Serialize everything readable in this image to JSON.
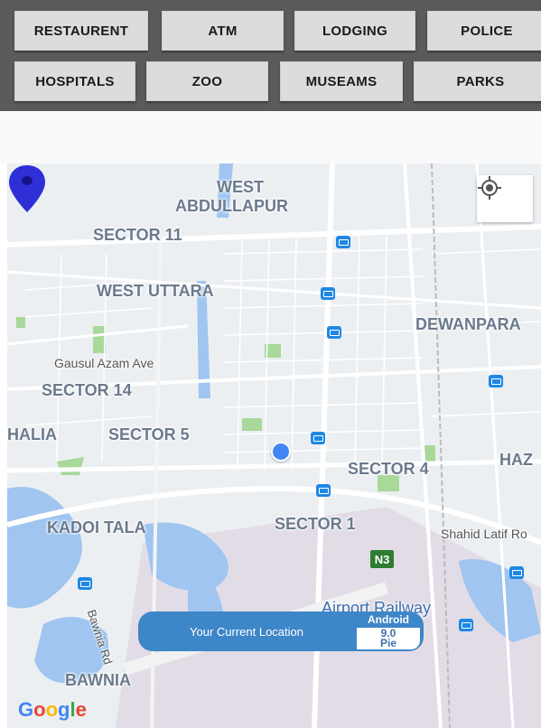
{
  "categories": [
    {
      "id": "restaurent",
      "label": "RESTAURENT"
    },
    {
      "id": "atm",
      "label": "ATM"
    },
    {
      "id": "lodging",
      "label": "LODGING"
    },
    {
      "id": "police",
      "label": "POLICE"
    },
    {
      "id": "hospitals",
      "label": "HOSPITALS"
    },
    {
      "id": "zoo",
      "label": "ZOO"
    },
    {
      "id": "museams",
      "label": "MUSEAMS"
    },
    {
      "id": "parks",
      "label": "PARKS"
    }
  ],
  "map": {
    "labels": {
      "west_abdullapur_1": "WEST",
      "west_abdullapur_2": "ABDULLAPUR",
      "sector_11": "SECTOR 11",
      "west_uttara": "WEST UTTARA",
      "dewanpara": "DEWANPARA",
      "gausul_azam_ave": "Gausul Azam Ave",
      "sector_14": "SECTOR 14",
      "halia": "HALIA",
      "sector_5": "SECTOR 5",
      "haz": "HAZ",
      "sector_4": "SECTOR 4",
      "kadoi_tala": "KADOI TALA",
      "sector_1": "SECTOR 1",
      "shahid_latif": "Shahid Latif Ro",
      "n3": "N3",
      "airport_railway": "Airport Railway",
      "bawnia_rd": "Bawnia Rd",
      "bawnia": "BAWNIA"
    },
    "toast": {
      "text": "Your Current Location",
      "badge_title": "Android",
      "badge_version": "9.0",
      "badge_name": "Pie"
    },
    "google_logo": [
      "G",
      "o",
      "o",
      "g",
      "l",
      "e"
    ],
    "colors": {
      "accent": "#3d86c8",
      "pin": "#2f2fd8",
      "bus": "#1e88e5",
      "park": "#a8d89a",
      "water": "#9fc5f0"
    }
  }
}
